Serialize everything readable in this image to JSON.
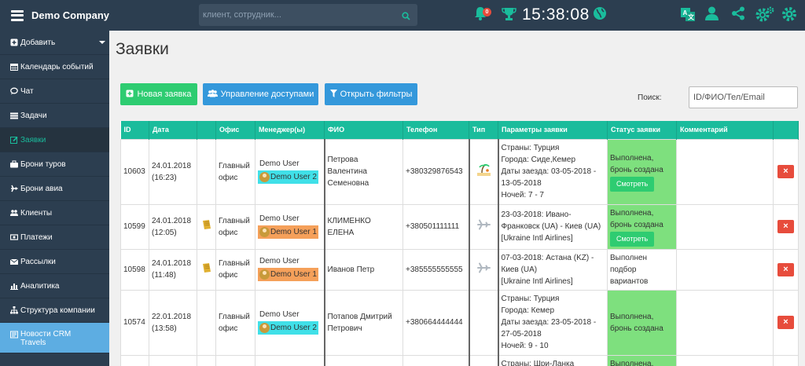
{
  "header": {
    "brand": "Demo Company",
    "search_placeholder": "клиент, сотрудник...",
    "notifications_count": "0",
    "time": "15:38:08",
    "icons": [
      "menu-icon",
      "search-icon",
      "bell-icon",
      "trophy-icon",
      "globe-icon",
      "translate-icon",
      "user-icon",
      "share-icon",
      "settings-icon"
    ]
  },
  "sidebar": {
    "items": [
      {
        "label": "Добавить",
        "icon": "plus-square-icon"
      },
      {
        "label": "Календарь событий",
        "icon": "calendar-icon"
      },
      {
        "label": "Чат",
        "icon": "chat-icon"
      },
      {
        "label": "Задачи",
        "icon": "tasks-icon"
      },
      {
        "label": "Заявки",
        "icon": "edit-icon"
      },
      {
        "label": "Брони туров",
        "icon": "suitcase-icon"
      },
      {
        "label": "Брони авиа",
        "icon": "plane-icon"
      },
      {
        "label": "Клиенты",
        "icon": "users-icon"
      },
      {
        "label": "Платежи",
        "icon": "money-icon"
      },
      {
        "label": "Рассылки",
        "icon": "envelope-icon"
      },
      {
        "label": "Аналитика",
        "icon": "bar-chart-icon"
      },
      {
        "label": "Структура компании",
        "icon": "sitemap-icon"
      },
      {
        "label": "Новости CRM Travels",
        "icon": "newspaper-icon"
      }
    ]
  },
  "main": {
    "title": "Заявки",
    "buttons": {
      "new": "Новая заявка",
      "access": "Управление доступами",
      "filters": "Открыть фильтры"
    },
    "search_label": "Поиск:",
    "search_placeholder": "ID/ФИО/Тел/Email"
  },
  "table": {
    "columns": [
      "ID",
      "Дата",
      "",
      "Офис",
      "Менеджер(ы)",
      "ФИО",
      "Телефон",
      "Тип",
      "Параметры заявки",
      "Статус заявки",
      "Комментарий",
      ""
    ],
    "rows": [
      {
        "id": "10603",
        "date": "24.01.2018",
        "time": "(16:23)",
        "doc_icon": "",
        "office1": "Главный",
        "office2": "офис",
        "manager": "Demo User",
        "manager_tag": "Demo User 2",
        "tag_color": "cyan",
        "fio": [
          "Петрова",
          "Валентина",
          "Семеновна"
        ],
        "phone": "+380329876543",
        "type": "beach-icon",
        "params": [
          "Страны: Турция",
          "Города: Сиде,Кемер",
          "Даты заезда: 03-05-2018 -",
          "13-05-2018",
          "Ночей: 7 - 7"
        ],
        "status": [
          "Выполнена,",
          "бронь создана"
        ],
        "status_green": true,
        "view_label": "Смотреть",
        "comment": ""
      },
      {
        "id": "10599",
        "date": "24.01.2018",
        "time": "(12:05)",
        "doc_icon": "document-icon",
        "office1": "Главный",
        "office2": "офис",
        "manager": "Demo User",
        "manager_tag": "Demo User 1",
        "tag_color": "orange",
        "fio": [
          "КЛИМЕНКО",
          "ЕЛЕНА"
        ],
        "phone": "+380501111111",
        "type": "plane-icon",
        "params": [
          "23-03-2018: Ивано-",
          "Франковск (UA) - Киев (UA)",
          "[Ukraine Intl Airlines]"
        ],
        "status": [
          "Выполнена,",
          "бронь создана"
        ],
        "status_green": true,
        "view_label": "Смотреть",
        "comment": ""
      },
      {
        "id": "10598",
        "date": "24.01.2018",
        "time": "(11:48)",
        "doc_icon": "document-icon",
        "office1": "Главный",
        "office2": "офис",
        "manager": "Demo User",
        "manager_tag": "Demo User 1",
        "tag_color": "orange",
        "fio": [
          "Иванов Петр"
        ],
        "phone": "+385555555555",
        "type": "plane-icon",
        "params": [
          "07-03-2018: Астана (KZ) -",
          "Киев (UA)",
          "[Ukraine Intl Airlines]"
        ],
        "status": [
          "Выполнен",
          "подбор",
          "вариантов"
        ],
        "status_green": false,
        "view_label": "",
        "comment": ""
      },
      {
        "id": "10574",
        "date": "22.01.2018",
        "time": "(13:58)",
        "doc_icon": "",
        "office1": "Главный",
        "office2": "офис",
        "manager": "Demo User",
        "manager_tag": "Demo User 2",
        "tag_color": "cyan",
        "fio": [
          "Потапов Дмитрий",
          "Петрович"
        ],
        "phone": "+380664444444",
        "type": "",
        "params": [
          "Страны: Турция",
          "Города: Кемер",
          "Даты заезда: 23-05-2018 -",
          "27-05-2018",
          "Ночей: 9 - 10"
        ],
        "status": [
          "Выполнена,",
          "бронь создана"
        ],
        "status_green": true,
        "view_label": "",
        "comment": ""
      },
      {
        "id": "",
        "date": "",
        "time": "",
        "doc_icon": "",
        "office1": "",
        "office2": "",
        "manager": "",
        "manager_tag": "",
        "tag_color": "",
        "fio": [],
        "phone": "",
        "type": "",
        "params": [
          "Страны: Шри-Ланка"
        ],
        "status": [
          "Выполнена,"
        ],
        "status_green": true,
        "view_label": "",
        "comment": ""
      }
    ]
  },
  "colors": {
    "nav_bg": "#2c3e50",
    "accent_teal": "#1abc9c",
    "btn_green": "#2ecc71",
    "btn_blue": "#3498db",
    "delete_red": "#e74c3c",
    "status_green": "#7ee07e",
    "tag_cyan": "#40e0e8",
    "tag_orange": "#f5a05a"
  }
}
